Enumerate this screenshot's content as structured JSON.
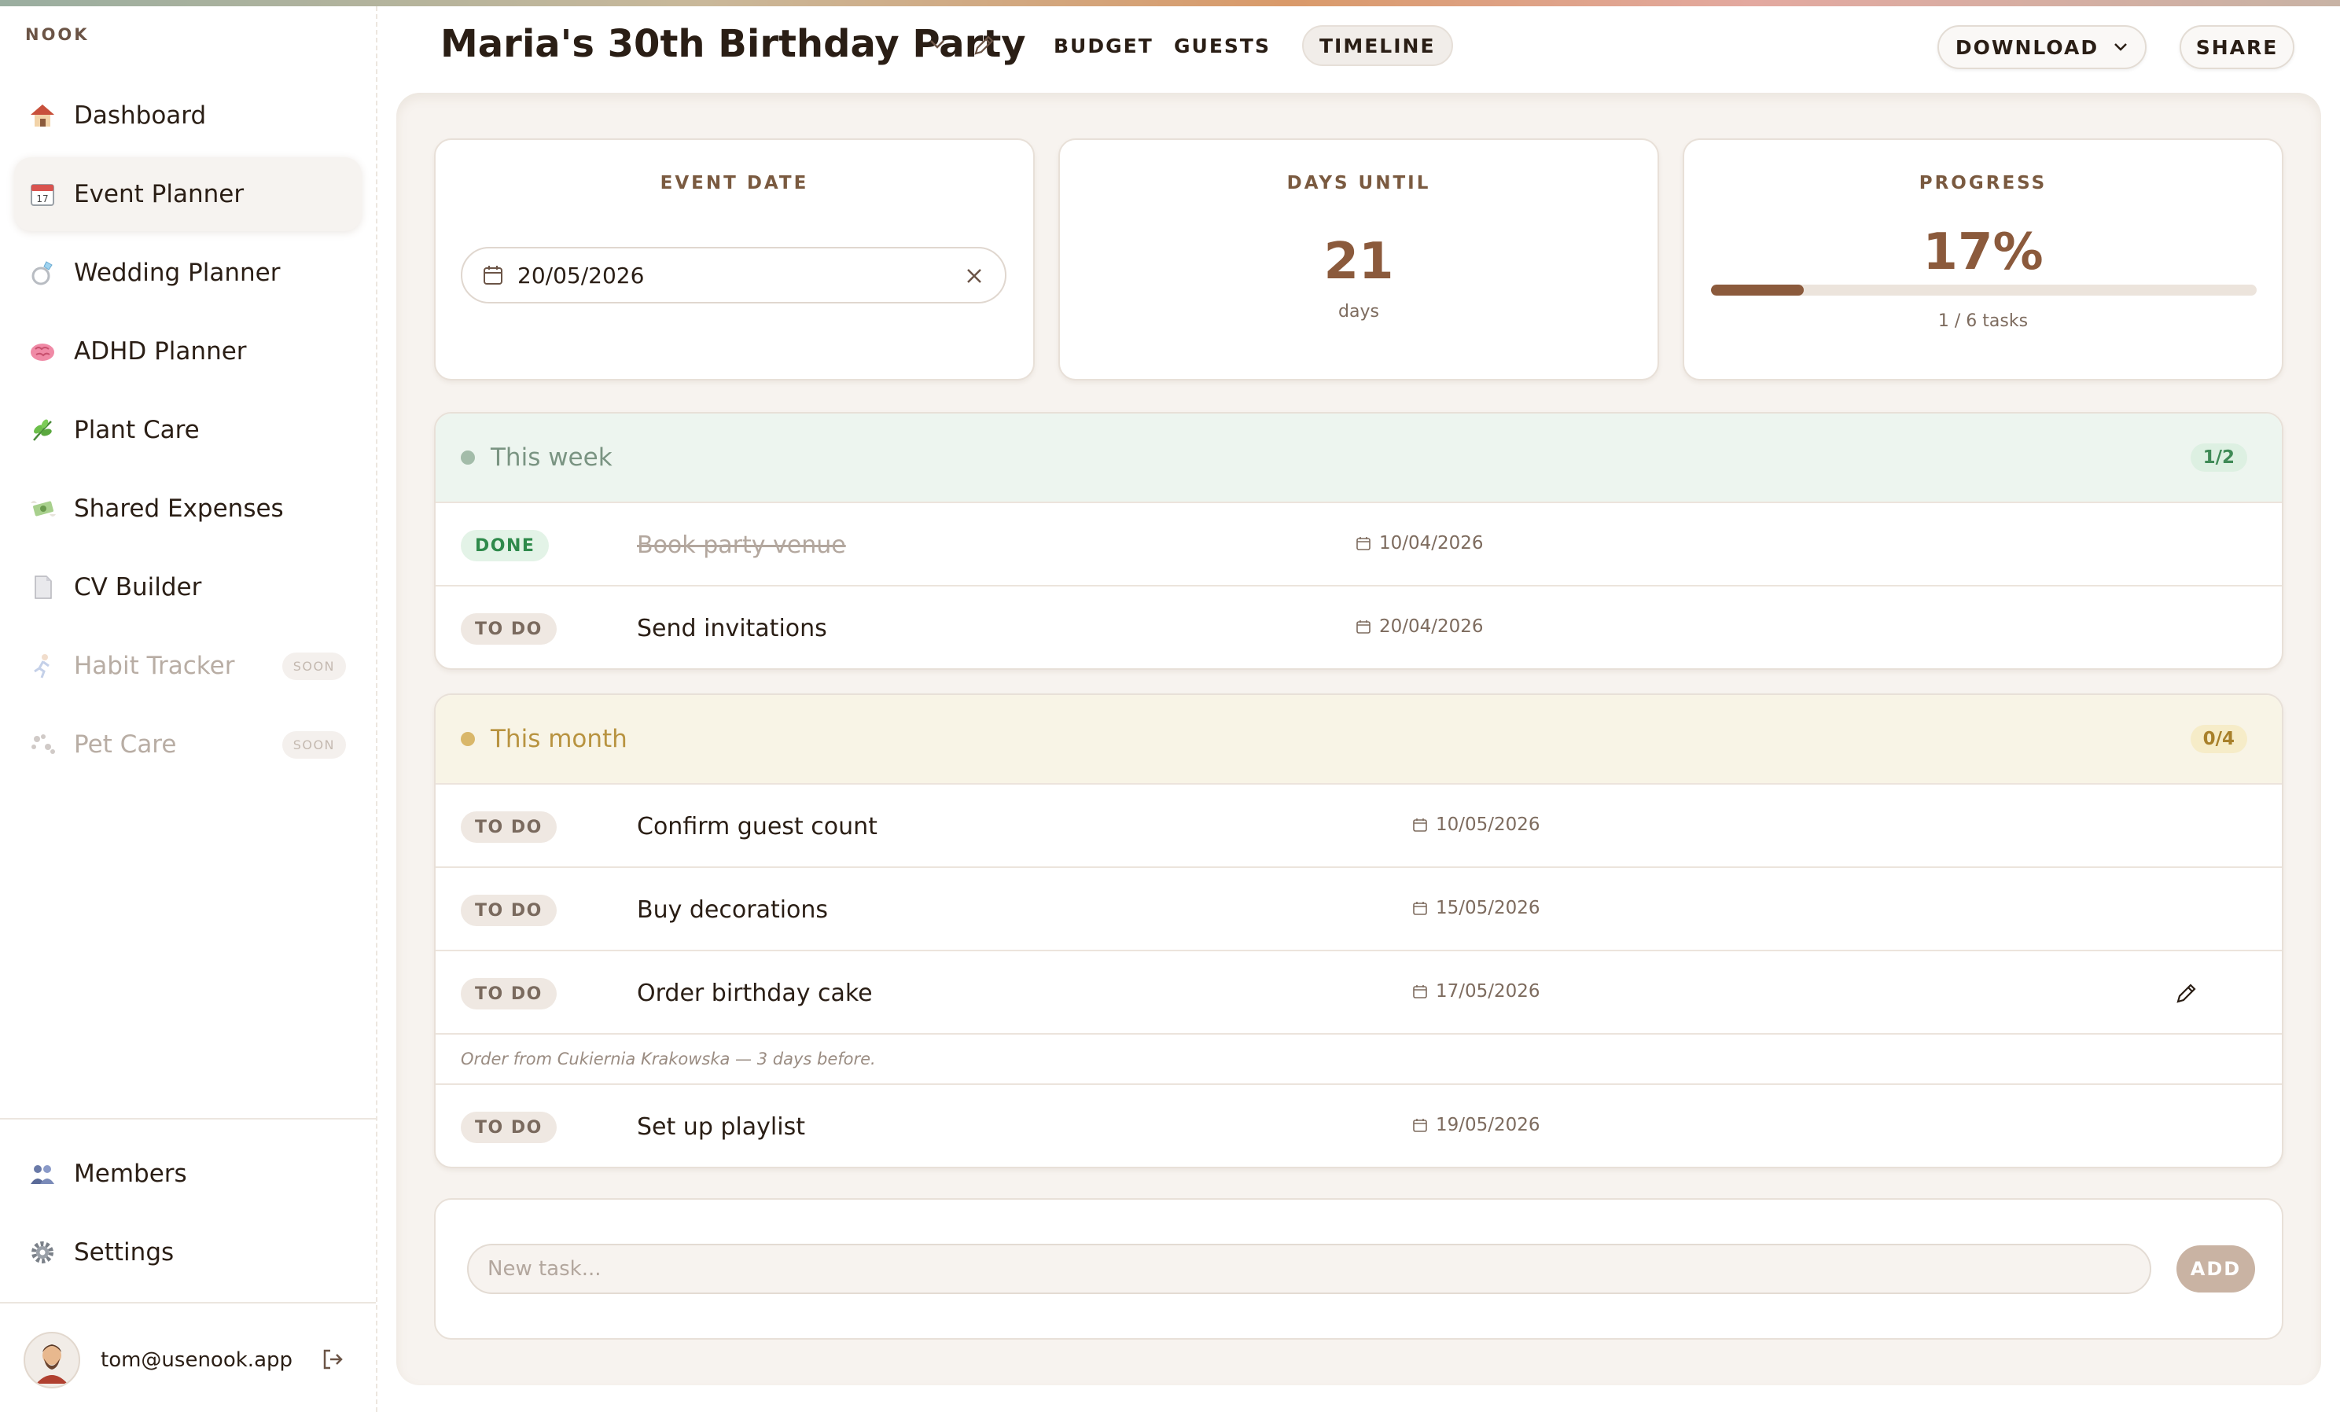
{
  "brand": "NOOK",
  "colors": {
    "accent": "#8b5a3c",
    "done_green": "#2f8a4b",
    "week_bg": "#edf5ef",
    "month_bg": "#f8f4e6",
    "month_accent": "#c9a24a"
  },
  "sidebar": {
    "items": [
      {
        "label": "Dashboard",
        "icon": "house-icon",
        "active": false,
        "disabled": false
      },
      {
        "label": "Event Planner",
        "icon": "calendar-icon",
        "active": true,
        "disabled": false
      },
      {
        "label": "Wedding Planner",
        "icon": "ring-icon",
        "active": false,
        "disabled": false
      },
      {
        "label": "ADHD Planner",
        "icon": "brain-icon",
        "active": false,
        "disabled": false
      },
      {
        "label": "Plant Care",
        "icon": "herb-icon",
        "active": false,
        "disabled": false
      },
      {
        "label": "Shared Expenses",
        "icon": "money-wings-icon",
        "active": false,
        "disabled": false
      },
      {
        "label": "CV Builder",
        "icon": "page-icon",
        "active": false,
        "disabled": false
      },
      {
        "label": "Habit Tracker",
        "icon": "runner-icon",
        "active": false,
        "disabled": true,
        "badge": "SOON"
      },
      {
        "label": "Pet Care",
        "icon": "paw-prints-icon",
        "active": false,
        "disabled": true,
        "badge": "SOON"
      }
    ],
    "bottom_items": [
      {
        "label": "Members",
        "icon": "people-icon"
      },
      {
        "label": "Settings",
        "icon": "gear-icon"
      }
    ],
    "user": {
      "email": "tom@usenook.app"
    }
  },
  "header": {
    "title": "Maria's 30th Birthday Party",
    "tabs": [
      {
        "label": "BUDGET",
        "active": false
      },
      {
        "label": "GUESTS",
        "active": false
      },
      {
        "label": "TIMELINE",
        "active": true
      }
    ],
    "download_label": "DOWNLOAD",
    "share_label": "SHARE"
  },
  "stats": {
    "event_date": {
      "title": "EVENT DATE",
      "value": "20/05/2026"
    },
    "days_until": {
      "title": "DAYS UNTIL",
      "value": "21",
      "unit": "days"
    },
    "progress": {
      "title": "PROGRESS",
      "value": "17%",
      "fraction": 0.17,
      "caption": "1 / 6 tasks"
    }
  },
  "sections": {
    "week": {
      "title": "This week",
      "count": "1/2",
      "tasks": [
        {
          "status": "DONE",
          "title": "Book party venue",
          "date": "10/04/2026"
        },
        {
          "status": "TO DO",
          "title": "Send invitations",
          "date": "20/04/2026"
        }
      ]
    },
    "month": {
      "title": "This month",
      "count": "0/4",
      "tasks": [
        {
          "status": "TO DO",
          "title": "Confirm guest count",
          "date": "10/05/2026"
        },
        {
          "status": "TO DO",
          "title": "Buy decorations",
          "date": "15/05/2026"
        },
        {
          "status": "TO DO",
          "title": "Order birthday cake",
          "date": "17/05/2026",
          "note": "Order from Cukiernia Krakowska — 3 days before."
        },
        {
          "status": "TO DO",
          "title": "Set up playlist",
          "date": "19/05/2026"
        }
      ]
    }
  },
  "new_task": {
    "placeholder": "New task...",
    "add_label": "ADD"
  }
}
